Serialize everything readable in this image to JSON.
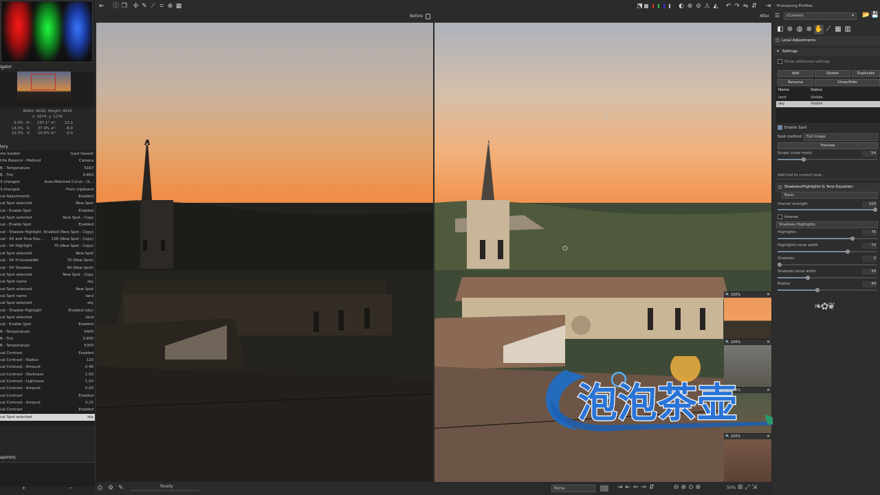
{
  "colors": {
    "accent": "#8aa0c0",
    "selected_row": "#d6d6d6",
    "panel_bg": "#2d2d2d"
  },
  "left": {
    "navigator_title": "igator",
    "nav_info": {
      "size": "Width: 6016, Height: 4016",
      "coords": "x: 1674, y: 2276"
    },
    "rgb_rows": [
      {
        "a": "9.0%",
        "b": "H:",
        "c": "197.1°",
        "d": "a*:",
        "e": "13.1"
      },
      {
        "a": "14.5%",
        "b": "S:",
        "c": "37.9%",
        "d": "a*:",
        "e": "-6.9"
      },
      {
        "a": "13.3%",
        "b": "V:",
        "c": "14.5%",
        "d": "b*:",
        "e": "-0.0"
      }
    ],
    "history_title": "tory",
    "history": [
      {
        "a": "oto loaded",
        "b": "(Last Saved)"
      },
      {
        "a": "hite Balance - Method",
        "b": "Camera"
      },
      {
        "a": "B - Temperature",
        "b": "5167"
      },
      {
        "a": "B - Tint",
        "b": "0.850"
      },
      {
        "a": "3 changed",
        "b": "Auto-Matched Curve - (S..."
      },
      {
        "a": "3 changed",
        "b": "From clipboard"
      },
      {
        "a": "cal Adjustments",
        "b": "Enabled"
      },
      {
        "a": "cal Spot selected",
        "b": "New Spot"
      },
      {
        "a": "cal - Enable Spot",
        "b": "Enabled"
      },
      {
        "a": "cal Spot selected",
        "b": "New Spot - Copy"
      },
      {
        "a": "cal - Enable Spot",
        "b": "Enabled"
      },
      {
        "a": "cal - Shadow Highlight",
        "b": "Enabled (New Spot - Copy)"
      },
      {
        "a": "cal - SH and Tone Equ...",
        "b": "100 (New Spot - Copy)"
      },
      {
        "a": "cal - SH Highlight",
        "b": "75 (New Spot - Copy)"
      },
      {
        "a": "cal Spot selected",
        "b": "New Spot"
      },
      {
        "a": "cal - SH H tonalwidth",
        "b": "70 (New Spot)"
      },
      {
        "a": "cal - SH Shadows",
        "b": "40 (New Spot)"
      },
      {
        "a": "cal Spot selected",
        "b": "New Spot - Copy"
      },
      {
        "a": "cal Spot name",
        "b": "sky"
      },
      {
        "a": "cal Spot selected",
        "b": "New Spot"
      },
      {
        "a": "cal Spot name",
        "b": "land"
      },
      {
        "a": "cal Spot selected",
        "b": "sky"
      },
      {
        "a": "cal - Shadow Highlight",
        "b": "Enabled (sky)"
      },
      {
        "a": "cal Spot selected",
        "b": "land"
      },
      {
        "a": "cal - Enable Spot",
        "b": "Enabled"
      },
      {
        "a": "B - Temperature",
        "b": "5400"
      },
      {
        "a": "B - Tint",
        "b": "0.830"
      },
      {
        "a": "B - Temperature",
        "b": "5300"
      },
      {
        "a": "cal Contrast",
        "b": "Enabled"
      },
      {
        "a": "cal Contrast - Radius",
        "b": "120"
      },
      {
        "a": "cal Contrast - Amount",
        "b": "0.46"
      },
      {
        "a": "cal Contrast - Darkness",
        "b": "1.00"
      },
      {
        "a": "cal Contrast - Lightness",
        "b": "1.00"
      },
      {
        "a": "cal Contrast - Amount",
        "b": "0.00"
      },
      {
        "a": "cal Contrast",
        "b": "Enabled"
      },
      {
        "a": "cal Contrast - Amount",
        "b": "0.15"
      },
      {
        "a": "cal Contrast",
        "b": "Enabled"
      },
      {
        "a": "cal Spot selected",
        "b": "sky"
      }
    ],
    "snapshots_title": "apshots",
    "snap_add": "+",
    "snap_remove": "−"
  },
  "labels": {
    "before": "Before",
    "after": "After"
  },
  "thumbs": [
    {
      "zoom": "100%"
    },
    {
      "zoom": "100%"
    },
    {
      "zoom": "100%"
    },
    {
      "zoom": "100%"
    }
  ],
  "bottom": {
    "status": "Ready",
    "select": "None",
    "zoom": "50%"
  },
  "right": {
    "profiles_title": "Processing Profiles",
    "profile_value": "(Custom)",
    "local_adjustments": "Local Adjustments",
    "settings": "Settings",
    "show_additional": "Show additional settings",
    "add": "Add",
    "delete": "Delete",
    "duplicate": "Duplicate",
    "rename": "Rename",
    "showhide": "Show/Hide",
    "spot_headers": {
      "name": "Name",
      "status": "Status"
    },
    "spots": [
      {
        "name": "land",
        "status": "Visible"
      },
      {
        "name": "sky",
        "status": "Visible"
      }
    ],
    "enable_spot": "Enable Spot",
    "spot_method": "Spot method",
    "spot_method_value": "Full image",
    "preview": "Preview",
    "scope_label": "Scope (color tools)",
    "scope_value": "54",
    "scope_frac": 0.26,
    "add_tool": "Add tool to current spot...",
    "sh_title": "Shadows/Highlights & Tone Equalizer",
    "sh_mode": "Basic",
    "overall_label": "Overall strength",
    "overall_value": "100",
    "overall_frac": 1.0,
    "inverse": "Inverse",
    "sh_method": "Shadows Highlights",
    "sliders": [
      {
        "label": "Highlights",
        "value": "75",
        "frac": 0.75
      },
      {
        "label": "Highlights tonal width",
        "value": "70",
        "frac": 0.7
      },
      {
        "label": "Shadows",
        "value": "0",
        "frac": 0.0
      },
      {
        "label": "Shadows tonal width",
        "value": "30",
        "frac": 0.3
      },
      {
        "label": "Radius",
        "value": "40",
        "frac": 0.4
      }
    ]
  },
  "watermark": {
    "text": "泡泡茶壶"
  }
}
